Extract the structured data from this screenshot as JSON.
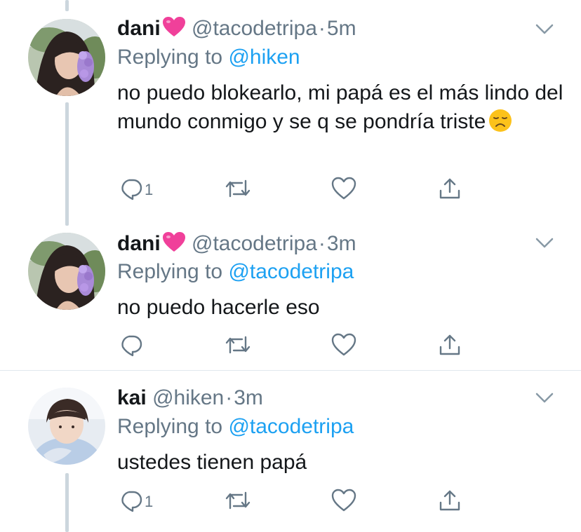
{
  "tweets": [
    {
      "name": "dani",
      "handle": "@tacodetripa",
      "separator": "·",
      "time": "5m",
      "replying_prefix": "Replying to",
      "replying_to": "@hiken",
      "text": "no puedo blokearlo, mi papá es el más lindo del mundo conmigo y se q se pondría triste",
      "emoji": "disappointed-face-icon",
      "reply_count": "1"
    },
    {
      "name": "dani",
      "handle": "@tacodetripa",
      "separator": "·",
      "time": "3m",
      "replying_prefix": "Replying to",
      "replying_to": "@tacodetripa",
      "text": "no puedo hacerle eso",
      "reply_count": ""
    },
    {
      "name": "kai",
      "handle": "@hiken",
      "separator": "·",
      "time": "3m",
      "replying_prefix": "Replying to",
      "replying_to": "@tacodetripa",
      "text": "ustedes tienen papá",
      "reply_count": "1"
    }
  ],
  "colors": {
    "text": "#14171a",
    "secondary": "#657786",
    "link": "#1da1f2",
    "thread_line": "#ccd6dd",
    "divider": "#e1e8ed",
    "heart_emoji": "#f0409a"
  }
}
